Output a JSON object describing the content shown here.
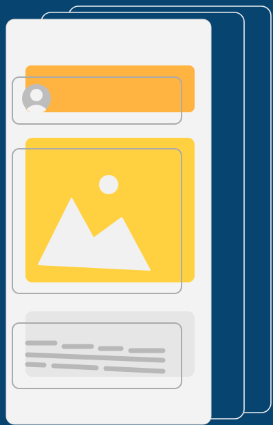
{
  "illustration": {
    "kind": "layered mobile screen wireframe",
    "background_color": "#07446f",
    "back_card_fill": "#07446f",
    "back_card_stroke": "#eef0f2",
    "front_card_fill": "#f3f3f3",
    "front_card_stroke": "#dedede",
    "outline_color": "#a9abad",
    "header_bar_color": "#ffb340",
    "image_panel_color": "#ffd140",
    "image_glyph_color": "#f1f1f1",
    "text_panel_color": "#e6e6e6",
    "text_line_color": "#b8b8b8",
    "avatar_color": "#bdbdbd",
    "icons": [
      "avatar-icon",
      "image-placeholder-icon"
    ],
    "text_line_rows": 3
  }
}
